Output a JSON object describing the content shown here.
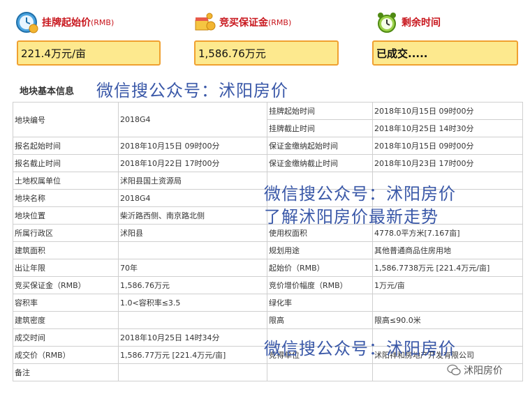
{
  "header": {
    "items": [
      {
        "label": "挂牌起始价",
        "unit": "(RMB)",
        "value": "221.4万元/亩"
      },
      {
        "label": "竞买保证金",
        "unit": "(RMB)",
        "value": "1,586.76万元"
      },
      {
        "label": "剩余时间",
        "unit": "",
        "value": "已成交....."
      }
    ]
  },
  "section_title": "地块基本信息",
  "watermarks": [
    "微信搜公众号：沭阳房价",
    "微信搜公众号：沭阳房价",
    "了解沭阳房价最新走势",
    "微信搜公众号：沭阳房价"
  ],
  "table": {
    "rows": [
      [
        "地块编号",
        "2018G4",
        "挂牌起始时间",
        "2018年10月15日 09时00分"
      ],
      [
        "",
        "",
        "挂牌截止时间",
        "2018年10月25日 14时30分"
      ],
      [
        "报名起始时间",
        "2018年10月15日 09时00分",
        "保证金缴纳起始时间",
        "2018年10月15日 09时00分"
      ],
      [
        "报名截止时间",
        "2018年10月22日 17时00分",
        "保证金缴纳截止时间",
        "2018年10月23日 17时00分"
      ],
      [
        "土地权属单位",
        "沭阳县国土资源局",
        "",
        ""
      ],
      [
        "地块名称",
        "2018G4",
        "",
        ""
      ],
      [
        "地块位置",
        "柴沂路西侧、南京路北侧",
        "",
        ""
      ],
      [
        "所属行政区",
        "沭阳县",
        "使用权面积",
        "4778.0平方米[7.167亩]"
      ],
      [
        "建筑面积",
        "",
        "规划用途",
        "其他普通商品住房用地"
      ],
      [
        "出让年限",
        "70年",
        "起始价（RMB）",
        "1,586.7738万元 [221.4万元/亩]"
      ],
      [
        "竞买保证金（RMB）",
        "1,586.76万元",
        "竞价增价幅度（RMB）",
        "1万元/亩"
      ],
      [
        "容积率",
        "1.0<容积率≤3.5",
        "绿化率",
        ""
      ],
      [
        "建筑密度",
        "",
        "限高",
        "限高≤90.0米"
      ],
      [
        "成交时间",
        "2018年10月25日 14时34分",
        "",
        ""
      ],
      [
        "成交价（RMB）",
        "1,586.77万元 [221.4万元/亩]",
        "竞得单位",
        "沭阳祥和房地产开发有限公司"
      ],
      [
        "备注",
        "",
        "",
        ""
      ]
    ]
  },
  "brand": "沭阳房价",
  "colors": {
    "accent_red": "#c8161d",
    "box_fill": "#fde98e",
    "box_border": "#f0a030",
    "watermark": "#3a58a8"
  }
}
